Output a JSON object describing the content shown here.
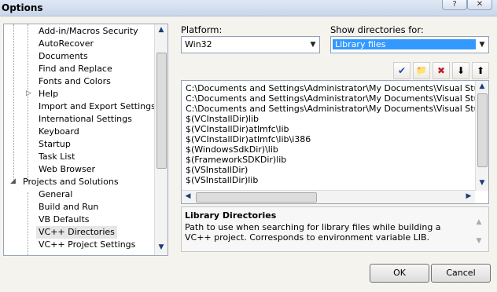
{
  "window": {
    "title": "Options",
    "help_glyph": "?",
    "close_glyph": "✕"
  },
  "tree": {
    "items": [
      {
        "label": "Add-in/Macros Security"
      },
      {
        "label": "AutoRecover"
      },
      {
        "label": "Documents"
      },
      {
        "label": "Find and Replace"
      },
      {
        "label": "Fonts and Colors"
      },
      {
        "label": "Help"
      },
      {
        "label": "Import and Export Settings"
      },
      {
        "label": "International Settings"
      },
      {
        "label": "Keyboard"
      },
      {
        "label": "Startup"
      },
      {
        "label": "Task List"
      },
      {
        "label": "Web Browser"
      },
      {
        "label": "Projects and Solutions"
      },
      {
        "label": "General"
      },
      {
        "label": "Build and Run"
      },
      {
        "label": "VB Defaults"
      },
      {
        "label": "VC++ Directories"
      },
      {
        "label": "VC++ Project Settings"
      }
    ]
  },
  "platform": {
    "label": "Platform:",
    "value": "Win32"
  },
  "show_dirs": {
    "label": "Show directories for:",
    "value": "Library files"
  },
  "toolbar": {
    "check_icon": "✔",
    "new_folder_icon": "📁",
    "delete_icon": "✖",
    "down_icon": "⬇",
    "up_icon": "⬆"
  },
  "directories": [
    "C:\\Documents and Settings\\Administrator\\My Documents\\Visual Studio",
    "C:\\Documents and Settings\\Administrator\\My Documents\\Visual Studio",
    "C:\\Documents and Settings\\Administrator\\My Documents\\Visual Studio",
    "$(VCInstallDir)lib",
    "$(VCInstallDir)atlmfc\\lib",
    "$(VCInstallDir)atlmfc\\lib\\i386",
    "$(WindowsSdkDir)\\lib",
    "$(FrameworkSDKDir)lib",
    "$(VSInstallDir)",
    "$(VSInstallDir)lib"
  ],
  "description": {
    "title": "Library Directories",
    "text": "Path to use when searching for library files while building a VC++ project.  Corresponds to environment variable LIB."
  },
  "buttons": {
    "ok": "OK",
    "cancel": "Cancel"
  },
  "scroll": {
    "up": "▲",
    "down": "▼",
    "left": "◀",
    "right": "▶"
  },
  "tree_glyphs": {
    "expand": "▷",
    "collapse": "◢"
  }
}
